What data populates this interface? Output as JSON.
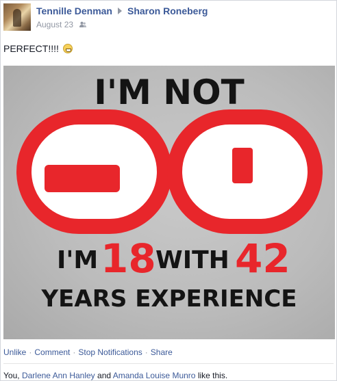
{
  "post": {
    "author": "Tennille Denman",
    "recipient": "Sharon Roneberg",
    "date": "August 23",
    "audience_icon": "friends-icon",
    "text": "PERFECT!!!!",
    "emoji": "grin-emoji",
    "image": {
      "line1": "I'M NOT",
      "big": "60",
      "line3_a": "I'M",
      "line3_num1": "18",
      "line3_b": "WITH",
      "line3_num2": "42",
      "line4": "YEARS EXPERIENCE",
      "accent_color": "#e8262b",
      "text_color": "#141414"
    }
  },
  "actions": {
    "unlike": "Unlike",
    "comment": "Comment",
    "stop_notifications": "Stop Notifications",
    "share": "Share",
    "separator": "·"
  },
  "likes": {
    "you": "You,",
    "person1": "Darlene Ann Hanley",
    "and": "and",
    "person2": "Amanda Louise Munro",
    "suffix": "like this."
  }
}
